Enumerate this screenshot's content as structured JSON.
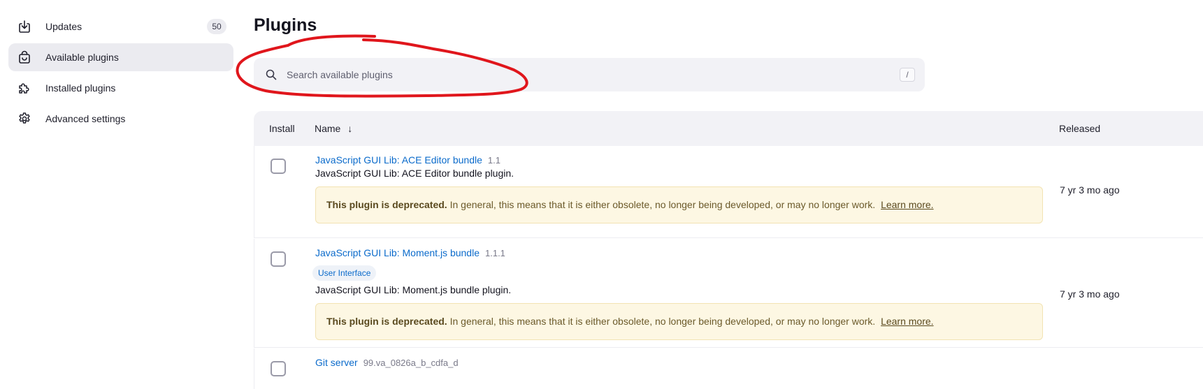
{
  "sidebar": {
    "items": [
      {
        "label": "Updates",
        "icon": "download-icon",
        "badge": "50"
      },
      {
        "label": "Available plugins",
        "icon": "shopping-bag-icon"
      },
      {
        "label": "Installed plugins",
        "icon": "puzzle-icon"
      },
      {
        "label": "Advanced settings",
        "icon": "gear-icon"
      }
    ]
  },
  "main": {
    "title": "Plugins",
    "search": {
      "placeholder": "Search available plugins",
      "value": "",
      "shortcut": "/"
    }
  },
  "table": {
    "headers": {
      "install": "Install",
      "name": "Name",
      "sort_indicator": "↓",
      "released": "Released"
    },
    "rows": [
      {
        "name": "JavaScript GUI Lib: ACE Editor bundle",
        "version": "1.1",
        "description": "JavaScript GUI Lib: ACE Editor bundle plugin.",
        "warning_bold": "This plugin is deprecated.",
        "warning_text": "In general, this means that it is either obsolete, no longer being developed, or may no longer work.",
        "warning_link": "Learn more.",
        "released": "7 yr 3 mo ago"
      },
      {
        "name": "JavaScript GUI Lib: Moment.js bundle",
        "version": "1.1.1",
        "tag": "User Interface",
        "description": "JavaScript GUI Lib: Moment.js bundle plugin.",
        "warning_bold": "This plugin is deprecated.",
        "warning_text": "In general, this means that it is either obsolete, no longer being developed, or may no longer work.",
        "warning_link": "Learn more.",
        "released": "7 yr 3 mo ago"
      },
      {
        "name": "Git server",
        "version": "99.va_0826a_b_cdfa_d"
      }
    ]
  },
  "colors": {
    "link": "#0b6bcb",
    "annotation": "#e0161c",
    "warning_bg": "#fdf7e3",
    "active_bg": "#ebebf0"
  }
}
